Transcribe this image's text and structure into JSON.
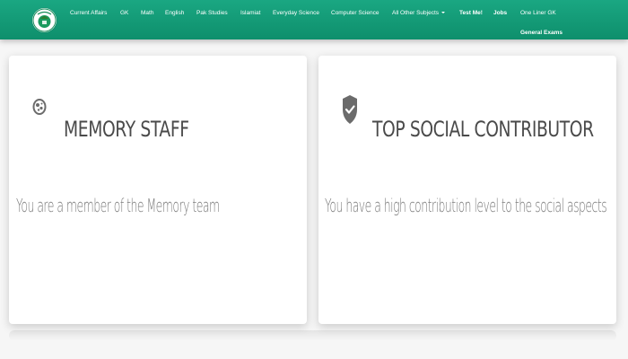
{
  "navbar": {
    "background": "#12a07b",
    "items": [
      {
        "label": "Current Affairs"
      },
      {
        "label": "GK"
      },
      {
        "label": "Math"
      },
      {
        "label": "English"
      },
      {
        "label": "Pak Studies"
      },
      {
        "label": "Islamiat"
      },
      {
        "label": "Everyday Science"
      },
      {
        "label": "Computer Science"
      },
      {
        "label": "All Other Subjects"
      },
      {
        "label": "Test Me!"
      },
      {
        "label": "Jobs"
      },
      {
        "label": "One Liner GK"
      },
      {
        "label": "General Exams"
      }
    ]
  },
  "cards": [
    {
      "icon": "memory-badge-icon",
      "title": "MEMORY STAFF",
      "description": "You are a member of the Memory team"
    },
    {
      "icon": "shield-check-icon",
      "title": "TOP SOCIAL CONTRIBUTOR",
      "description": "You have a high contribution level to the social aspects"
    }
  ],
  "colors": {
    "accent": "#12a07b",
    "title_text": "#4a4a4a",
    "desc_text": "#7a7a7a",
    "icon_gray": "#6b6b6b"
  }
}
